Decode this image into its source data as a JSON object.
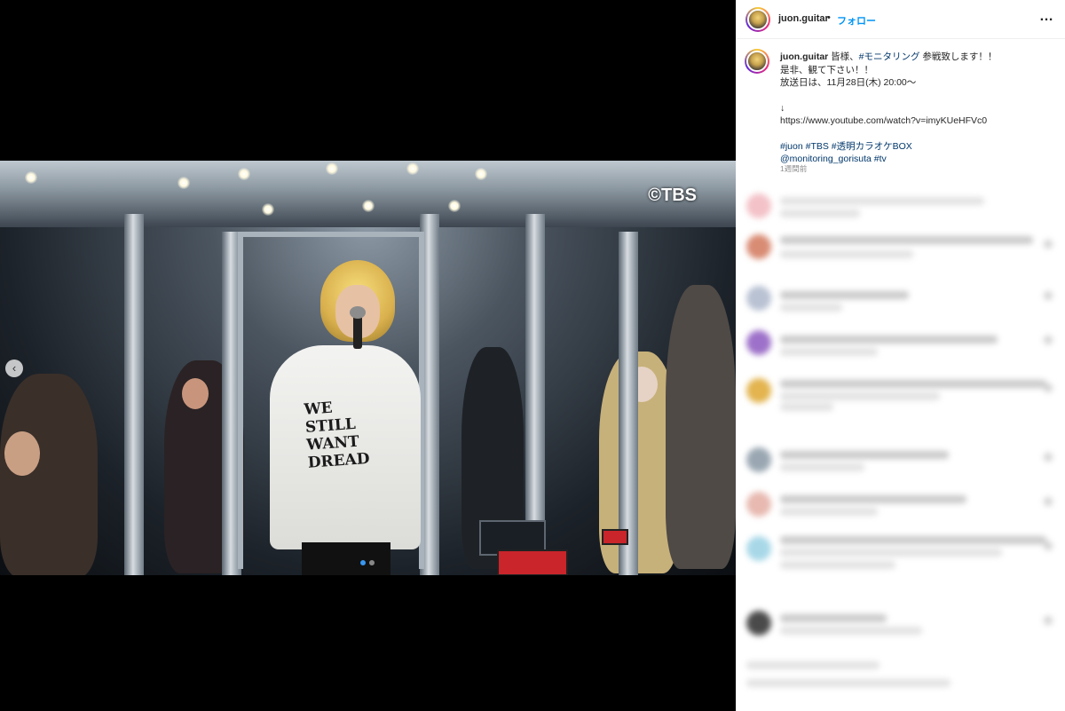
{
  "media": {
    "watermark": "©TBS",
    "shirt_print": "WE\nSTILL\nWANT\nDREAD",
    "carousel_dots": 2,
    "active_dot": 0
  },
  "post": {
    "username": "juon.guitar",
    "separator": "•",
    "follow_label": "フォロー",
    "more_icon": "…",
    "caption": {
      "username": "juon.guitar",
      "line1_pre": " 皆様、",
      "line1_tag": "#モニタリング",
      "line1_post": " 参戦致します！！",
      "line2": "是非、観て下さい！！",
      "line3": "放送日は、11月28日(木) 20:00〜",
      "line4": "↓",
      "line5": "https://www.youtube.com/watch?v=imyKUeHFVc0",
      "tags_line1": "#juon #TBS #透明カラオケBOX",
      "tags_line2": "@monitoring_gorisuta #tv"
    },
    "time_ago": "1週間前"
  },
  "colors": {
    "link": "#0095f6",
    "hashtag": "#00376b",
    "active_dot": "#3897f0"
  }
}
